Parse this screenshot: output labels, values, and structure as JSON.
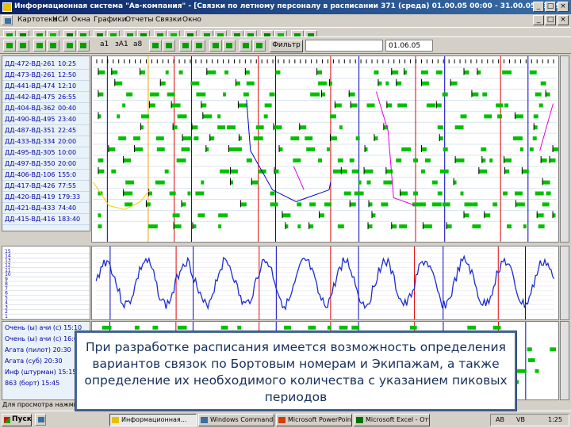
{
  "window": {
    "title": "Информационная система \"Ав-компания\" - [Связки по летному персоналу в расписании 371 (среда) 01.00.05 00:00 - 31.00.05 23:59]",
    "controls": [
      "_",
      "□",
      "×"
    ],
    "inner_controls": [
      "_",
      "□",
      "×"
    ]
  },
  "menu": [
    "Картотека",
    "НСИ",
    "Окна",
    "Графики",
    "Отчеты",
    "Связки",
    "Окно"
  ],
  "toolbar": {
    "labels": [
      "а1",
      "зА1",
      "а8"
    ],
    "filter_label": "Фильтр",
    "date_value": "01.06.05"
  },
  "rows": [
    {
      "code": "ДД-472-ВД-261",
      "time": "10:25"
    },
    {
      "code": "ДД-473-ВД-261",
      "time": "12:50"
    },
    {
      "code": "ДД-441-ВД-474",
      "time": "12:10"
    },
    {
      "code": "ДД-442-ВД-475",
      "time": "26:55"
    },
    {
      "code": "ДД-404-ВД-362",
      "time": "00:40"
    },
    {
      "code": "ДД-490-ВД-495",
      "time": "23:40"
    },
    {
      "code": "ДД-487-ВД-351",
      "time": "22:45"
    },
    {
      "code": "ДД-433-ВД-334",
      "time": "20:00"
    },
    {
      "code": "ДД-495-ВД-305",
      "time": "10:00"
    },
    {
      "code": "ДД-497-ВД-350",
      "time": "20:00"
    },
    {
      "code": "ДД-406-ВД-106",
      "time": "155:0"
    },
    {
      "code": "ДД-417-ВД-426",
      "time": "77:55"
    },
    {
      "code": "ДД-420-ВД-419",
      "time": "179:33"
    },
    {
      "code": "ДД-421-ВД-433",
      "time": "74:40"
    },
    {
      "code": "ДД-415-ВД-416",
      "time": "183:40"
    }
  ],
  "scale": [
    "15",
    "14",
    "13",
    "12",
    "11",
    "10",
    "9",
    "8",
    "7",
    "6",
    "5",
    "4",
    "3",
    "2",
    "1"
  ],
  "bottom_rows": [
    {
      "label": "Очень (ы) ачи (с)",
      "time": "15:10"
    },
    {
      "label": "Очень (ы) ачи (с)",
      "time": "16:00"
    },
    {
      "label": "Агата (пилот)",
      "time": "20:30"
    },
    {
      "label": "Агата (суб)",
      "time": "20:30"
    },
    {
      "label": "Инф (штурман)",
      "time": "15:15"
    },
    {
      "label": "863 (борт)",
      "time": "15:45"
    }
  ],
  "status_text": "Для просмотра нажмите F1",
  "taskbar": {
    "start": "Пуск",
    "tasks": [
      "Информационная...",
      "Windows Commander...",
      "Microsoft PowerPoint...",
      "Microsoft Excel - Отче..."
    ],
    "tray": [
      "AB",
      "VB",
      "1:25"
    ]
  },
  "caption": "При разработке расписания имеется возможность определения вариантов связок по Бортовым номерам и Экипажам, а также определение их необходимого количества с указанием пиковых периодов",
  "colors": {
    "title_start": "#0a246a",
    "title_end": "#3a6ea5",
    "bar_green": "#00c000",
    "line_blue": "#0000c0",
    "line_red": "#e00000",
    "wave_blue": "#1a2acc",
    "magenta": "#e000e0",
    "yellow": "#f0d000",
    "caption_text": "#16305a"
  }
}
